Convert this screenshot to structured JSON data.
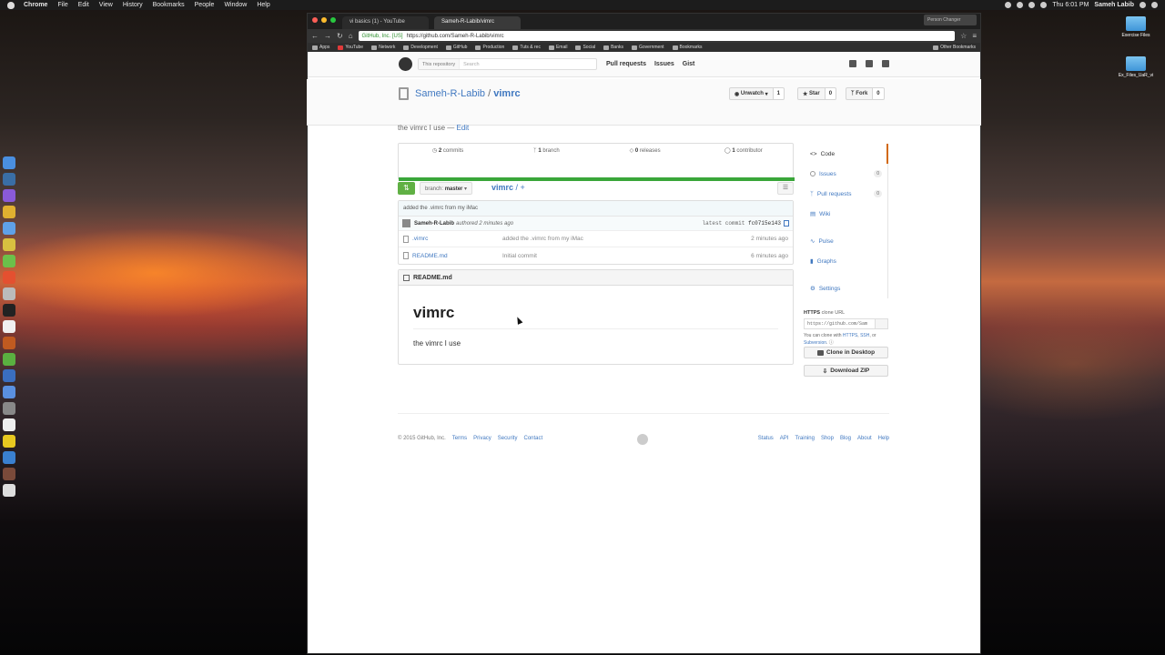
{
  "menubar": {
    "app": "Chrome",
    "items": [
      "File",
      "Edit",
      "View",
      "History",
      "Bookmarks",
      "People",
      "Window",
      "Help"
    ],
    "clock": "Thu 6:01 PM",
    "user": "Sameh Labib"
  },
  "desktop": {
    "icons": [
      "Exercise Files",
      "Ex_Files_UaR_vi"
    ]
  },
  "browser": {
    "tabs": [
      "vi basics (1) - YouTube",
      "Sameh-R-Labib/vimrc"
    ],
    "profile": "Person Changer",
    "secure_label": "GitHub, Inc. [US]",
    "url": "https://github.com/Sameh-R-Labib/vimrc",
    "bookmarks": [
      "Apps",
      "YouTube",
      "Network",
      "Development",
      "GitHub",
      "Production",
      "Tuts & rec",
      "Email",
      "Social",
      "Banks",
      "Government",
      "Bookmarks",
      "Other Bookmarks"
    ]
  },
  "github": {
    "scope_label": "This repository",
    "search_placeholder": "Search",
    "nav": [
      "Pull requests",
      "Issues",
      "Gist"
    ],
    "owner": "Sameh-R-Labib",
    "separator": "/",
    "repo": "vimrc",
    "watch_label": "Unwatch",
    "watch_count": "1",
    "star_label": "Star",
    "star_count": "0",
    "fork_label": "Fork",
    "fork_count": "0",
    "description": "the vimrc I use",
    "desc_sep": "—",
    "edit_label": "Edit",
    "stats": {
      "commits": "2",
      "commits_label": "commits",
      "branches": "1",
      "branches_label": "branch",
      "releases": "0",
      "releases_label": "releases",
      "contributors": "1",
      "contributors_label": "contributor"
    },
    "branch_prefix": "branch:",
    "branch": "master",
    "path_root": "vimrc",
    "path_add": "/ +",
    "latest_commit_message": "added the .vimrc from my iMac",
    "commit_author": "Sameh-R-Labib",
    "commit_when": "authored 2 minutes ago",
    "latest_commit_label": "latest commit",
    "commit_sha": "fc0715e143",
    "files": [
      {
        "name": ".vimrc",
        "message": "added the .vimrc from my iMac",
        "age": "2 minutes ago"
      },
      {
        "name": "README.md",
        "message": "Initial commit",
        "age": "6 minutes ago"
      }
    ],
    "readme": {
      "file": "README.md",
      "heading": "vimrc",
      "body": "the vimrc I use"
    },
    "sidenav": {
      "code": "Code",
      "issues": "Issues",
      "issues_count": "0",
      "pulls": "Pull requests",
      "pulls_count": "0",
      "wiki": "Wiki",
      "pulse": "Pulse",
      "graphs": "Graphs",
      "settings": "Settings"
    },
    "clone": {
      "protocol": "HTTPS",
      "label": "clone URL",
      "url": "https://github.com/Sameh-R-Labib/vimrc.git",
      "note_prefix": "You can clone with",
      "https": "HTTPS",
      "ssh": "SSH",
      "note_or": "or",
      "subversion": "Subversion"
    },
    "clone_desktop": "Clone in Desktop",
    "download_zip": "Download ZIP",
    "footer": {
      "copyright": "© 2015 GitHub, Inc.",
      "left_links": [
        "Terms",
        "Privacy",
        "Security",
        "Contact"
      ],
      "right_links": [
        "Status",
        "API",
        "Training",
        "Shop",
        "Blog",
        "About",
        "Help"
      ]
    }
  },
  "colors": {
    "link": "#4078c0",
    "green": "#60b044",
    "accent": "#d26911"
  }
}
